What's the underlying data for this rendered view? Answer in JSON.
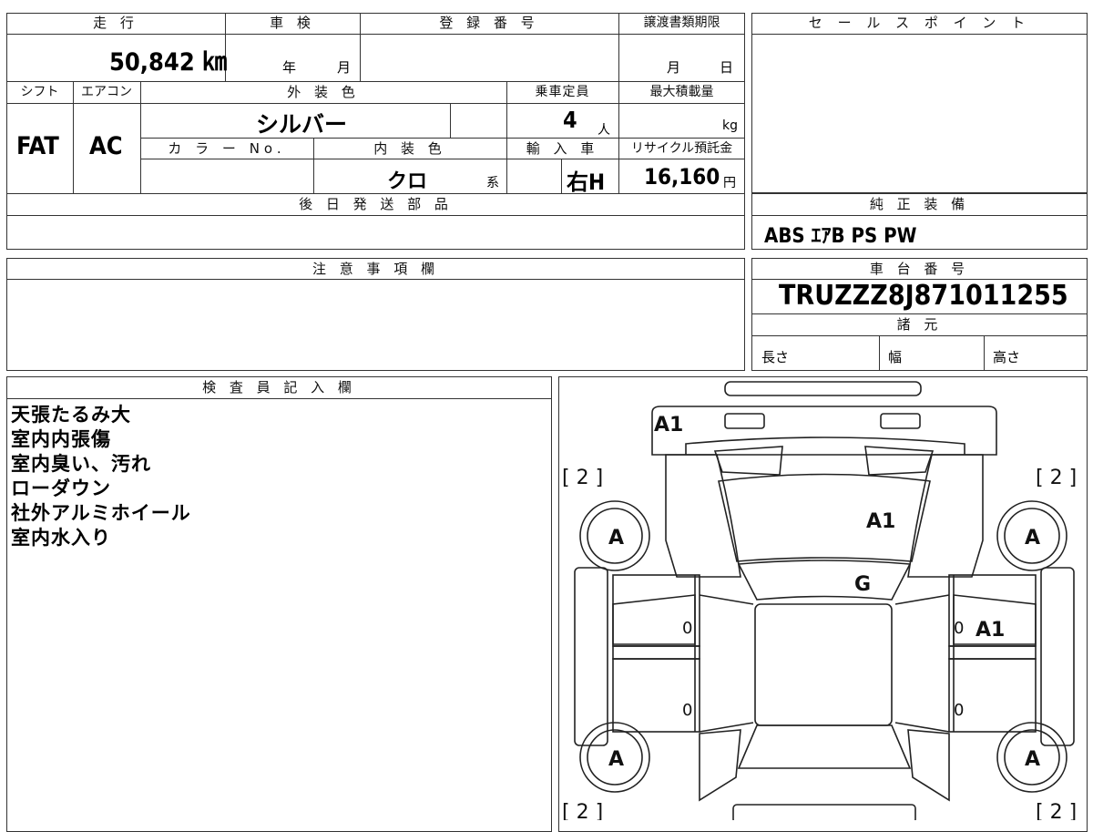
{
  "sheet": {
    "mileage_label": "走 行",
    "mileage_value": "50,842 ㎞",
    "shaken_label": "車 検",
    "shaken_year": "年",
    "shaken_month": "月",
    "registration_label": "登 録 番 号",
    "transfer_label": "譲渡書類期限",
    "transfer_month": "月",
    "transfer_day": "日",
    "shift_label": "シフト",
    "aircon_label": "エアコン",
    "exterior_label": "外 装 色",
    "capacity_label": "乗車定員",
    "maxload_label": "最大積載量",
    "shift_value": "FAT",
    "aircon_value": "AC",
    "exterior_value": "シルバー",
    "capacity_value": "4",
    "capacity_unit": "人",
    "maxload_unit": "kg",
    "colorno_label": "カ ラ ー No.",
    "interior_label": "内 装 色",
    "import_label": "輸 入 車",
    "recycle_label": "リサイクル預託金",
    "interior_value": "クロ",
    "interior_suffix": "系",
    "import_value": "右H",
    "recycle_value": "16,160",
    "recycle_unit": "円",
    "later_parts_label": "後 日 発 送 部 品",
    "notes_label": "注 意 事 項 欄",
    "inspector_label": "検 査 員 記 入 欄",
    "inspector_notes": [
      "天張たるみ大",
      "室内内張傷",
      "室内臭い、汚れ",
      "ローダウン",
      "社外アルミホイール",
      "室内水入り"
    ]
  },
  "side": {
    "sales_point_label": "セ ー ル ス ポ イ ン ト",
    "genuine_equipment_label": "純 正 装 備",
    "genuine_equipment_value": "ABS ｴｱB PS PW",
    "chassis_label": "車 台 番 号",
    "chassis_value": "TRUZZZ8J871011255",
    "specs_label": "諸 元",
    "length_label": "長さ",
    "width_label": "幅",
    "height_label": "高さ"
  },
  "diagram": {
    "front_a1": "A1",
    "left_front_count": "[ 2 ]",
    "right_front_count": "[ 2 ]",
    "left_rear_count": "[ 2 ]",
    "right_rear_count": "[ 2 ]",
    "wheel_fl": "A",
    "wheel_fr": "A",
    "wheel_rl": "A",
    "wheel_rr": "A",
    "hood_mark": "A1",
    "windshield_mark": "G",
    "right_door_mark": "A1",
    "door_zero_1": "0",
    "door_zero_2": "0",
    "door_zero_3": "0",
    "door_zero_4": "0"
  }
}
